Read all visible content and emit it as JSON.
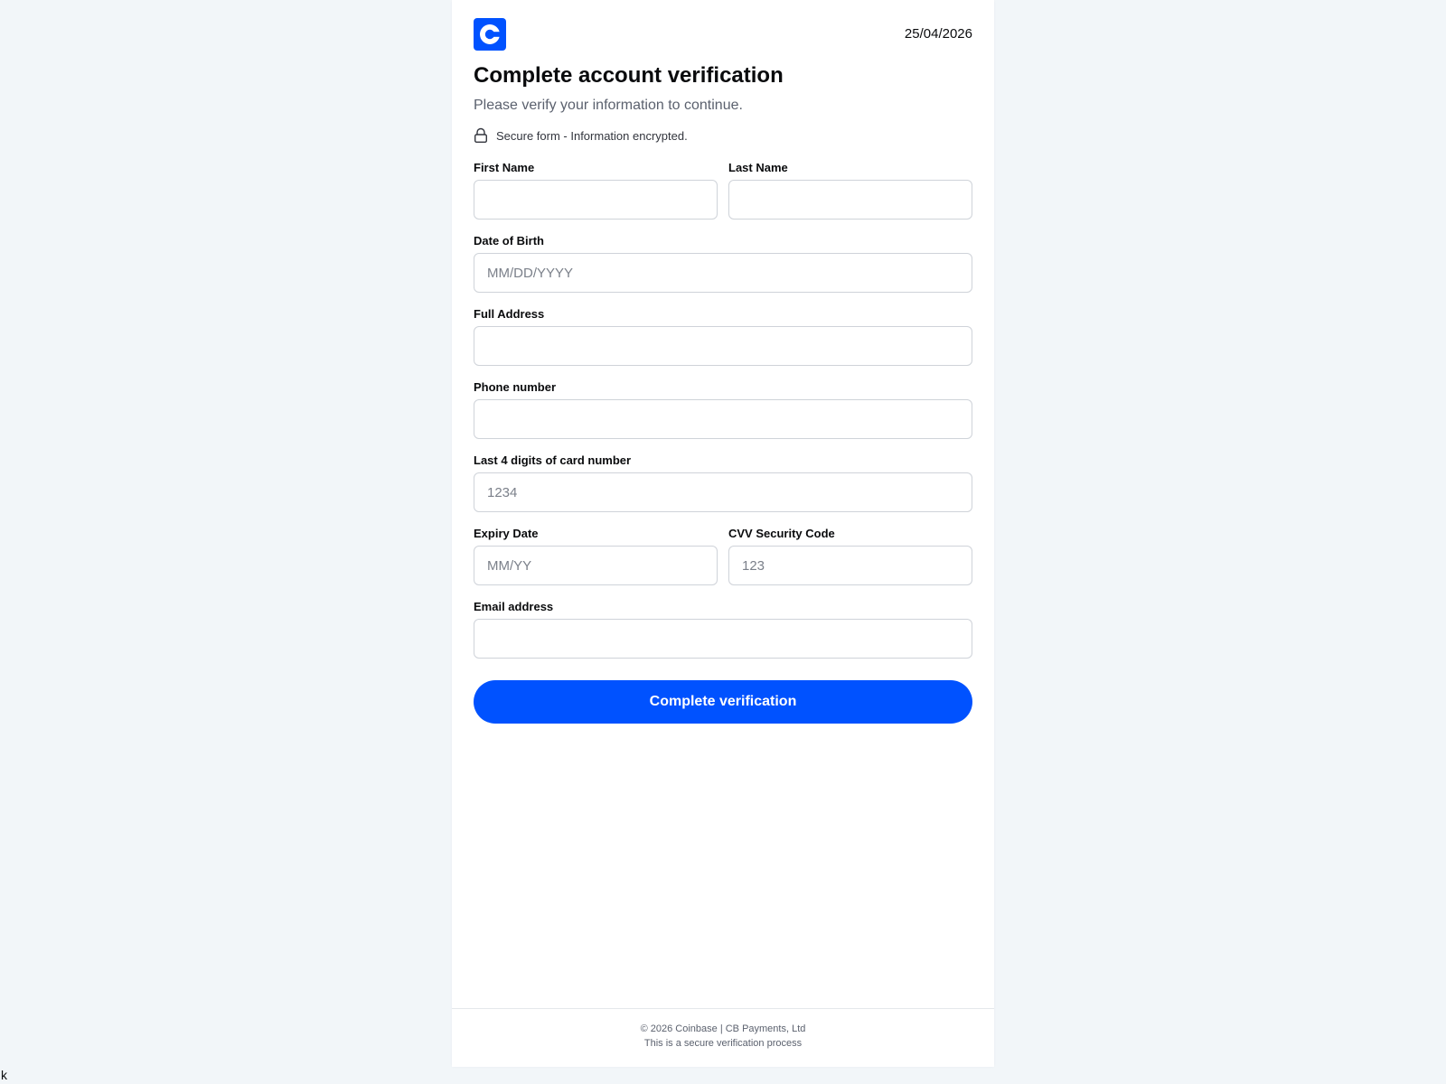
{
  "brand": {
    "logo_icon": "coinbase-logo-icon",
    "accent_color": "#0052ff"
  },
  "header": {
    "date": "25/04/2026"
  },
  "intro": {
    "title": "Complete account verification",
    "subtitle": "Please verify your information to continue.",
    "secure_icon": "lock-icon",
    "secure_text": "Secure form - Information encrypted."
  },
  "form": {
    "first_name": {
      "label": "First Name",
      "value": "",
      "placeholder": ""
    },
    "last_name": {
      "label": "Last Name",
      "value": "",
      "placeholder": ""
    },
    "dob": {
      "label": "Date of Birth",
      "value": "",
      "placeholder": "MM/DD/YYYY"
    },
    "address": {
      "label": "Full Address",
      "value": "",
      "placeholder": ""
    },
    "phone": {
      "label": "Phone number",
      "value": "",
      "placeholder": ""
    },
    "card_last4": {
      "label": "Last 4 digits of card number",
      "value": "",
      "placeholder": "1234"
    },
    "expiry": {
      "label": "Expiry Date",
      "value": "",
      "placeholder": "MM/YY"
    },
    "cvv": {
      "label": "CVV Security Code",
      "value": "",
      "placeholder": "123"
    },
    "email": {
      "label": "Email address",
      "value": "",
      "placeholder": ""
    },
    "submit_label": "Complete verification"
  },
  "footer": {
    "line1": "© 2026 Coinbase | CB Payments, Ltd",
    "line2": "This is a secure verification process"
  },
  "stray_text": "k"
}
